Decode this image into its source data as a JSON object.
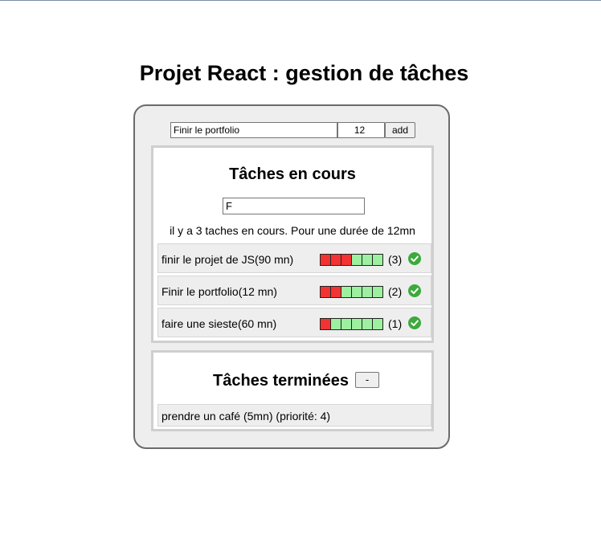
{
  "page": {
    "title": "Projet React : gestion de tâches"
  },
  "add_form": {
    "name_value": "Finir le portfolio",
    "duration_value": "12",
    "add_label": "add"
  },
  "current": {
    "heading": "Tâches en cours",
    "filter_value": "F",
    "summary": "il y a 3 taches en cours. Pour une durée de 12mn",
    "tasks": [
      {
        "label": "finir le projet de JS(90 mn)",
        "priority": 3,
        "priority_text": "(3)",
        "max": 6,
        "icon": "check-circle-icon"
      },
      {
        "label": "Finir le portfolio(12 mn)",
        "priority": 2,
        "priority_text": "(2)",
        "max": 6,
        "icon": "check-circle-icon"
      },
      {
        "label": "faire une sieste(60 mn)",
        "priority": 1,
        "priority_text": "(1)",
        "max": 6,
        "icon": "check-circle-icon"
      }
    ]
  },
  "done": {
    "heading": "Tâches terminées",
    "toggle_label": "-",
    "items": [
      {
        "label": "prendre un café (5mn) (priorité: 4)"
      }
    ]
  },
  "colors": {
    "priority_on": "#f23333",
    "priority_off": "#9df0a0",
    "check": "#3caa3c"
  }
}
